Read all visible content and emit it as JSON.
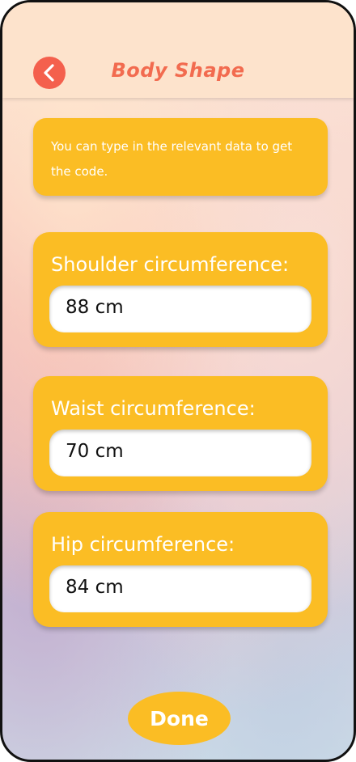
{
  "header": {
    "title": "Body Shape",
    "back_icon": "chevron-left-icon"
  },
  "info": {
    "text": "You can type in the relevant data to get the code."
  },
  "fields": [
    {
      "label": "Shoulder circumference:",
      "value": "88 cm"
    },
    {
      "label": "Waist circumference:",
      "value": "70 cm"
    },
    {
      "label": "Hip circumference:",
      "value": "84 cm"
    }
  ],
  "footer": {
    "done_label": "Done"
  },
  "colors": {
    "accent": "#fbbd24",
    "back_button": "#f4604d",
    "title": "#f26b4f",
    "header_bg": "#fde3cc"
  }
}
